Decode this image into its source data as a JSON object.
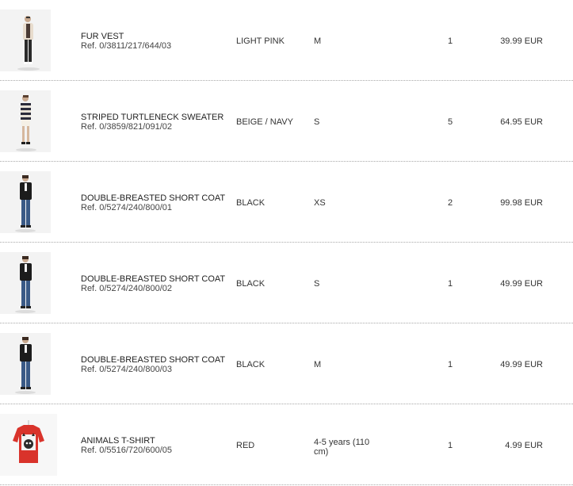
{
  "order_items": [
    {
      "image_icon": "product-photo-fur-vest",
      "name": "FUR VEST",
      "ref": "Ref. 0/3811/217/644/03",
      "color": "LIGHT PINK",
      "size": "M",
      "quantity": "1",
      "price": "39.99 EUR"
    },
    {
      "image_icon": "product-photo-striped-turtleneck",
      "name": "STRIPED TURTLENECK SWEATER",
      "ref": "Ref. 0/3859/821/091/02",
      "color": "BEIGE / NAVY",
      "size": "S",
      "quantity": "5",
      "price": "64.95 EUR"
    },
    {
      "image_icon": "product-photo-short-coat",
      "name": "DOUBLE-BREASTED SHORT COAT",
      "ref": "Ref. 0/5274/240/800/01",
      "color": "BLACK",
      "size": "XS",
      "quantity": "2",
      "price": "99.98 EUR"
    },
    {
      "image_icon": "product-photo-short-coat",
      "name": "DOUBLE-BREASTED SHORT COAT",
      "ref": "Ref. 0/5274/240/800/02",
      "color": "BLACK",
      "size": "S",
      "quantity": "1",
      "price": "49.99 EUR"
    },
    {
      "image_icon": "product-photo-short-coat",
      "name": "DOUBLE-BREASTED SHORT COAT",
      "ref": "Ref. 0/5274/240/800/03",
      "color": "BLACK",
      "size": "M",
      "quantity": "1",
      "price": "49.99 EUR"
    },
    {
      "image_icon": "product-photo-animals-tshirt",
      "name": "ANIMALS T-SHIRT",
      "ref": "Ref. 0/5516/720/600/05",
      "color": "RED",
      "size": "4-5 years (110 cm)",
      "quantity": "1",
      "price": "4.99 EUR"
    }
  ],
  "colors": {
    "text": "#333333",
    "divider": "#a8a8a8",
    "tshirt_red": "#d9332b",
    "coat_black": "#1c1c1c",
    "jeans_blue": "#3a5a86"
  }
}
